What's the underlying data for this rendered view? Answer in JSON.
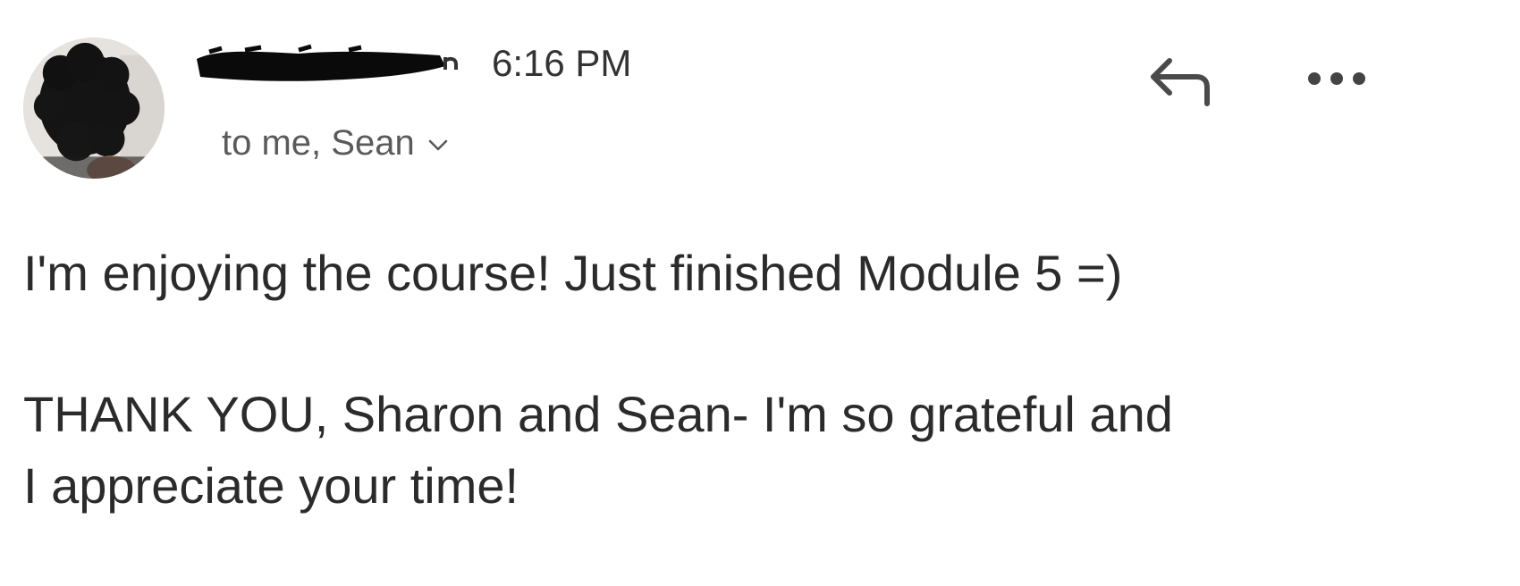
{
  "message": {
    "sender": {
      "avatar_icon": "user-photo-avatar",
      "name_redacted": true
    },
    "time": "6:16 PM",
    "recipients": "to me, Sean",
    "actions": {
      "reply_icon": "reply-arrow-icon",
      "more_icon": "more-horizontal-icon"
    },
    "body": {
      "line1": "I'm enjoying the course! Just finished Module 5 =)",
      "line2": "THANK YOU, Sharon and Sean- I'm so grateful and",
      "line3": "I appreciate your time!"
    }
  },
  "colors": {
    "text_primary": "#2b2b2b",
    "text_secondary": "#5a5a5a",
    "background": "#ffffff"
  }
}
